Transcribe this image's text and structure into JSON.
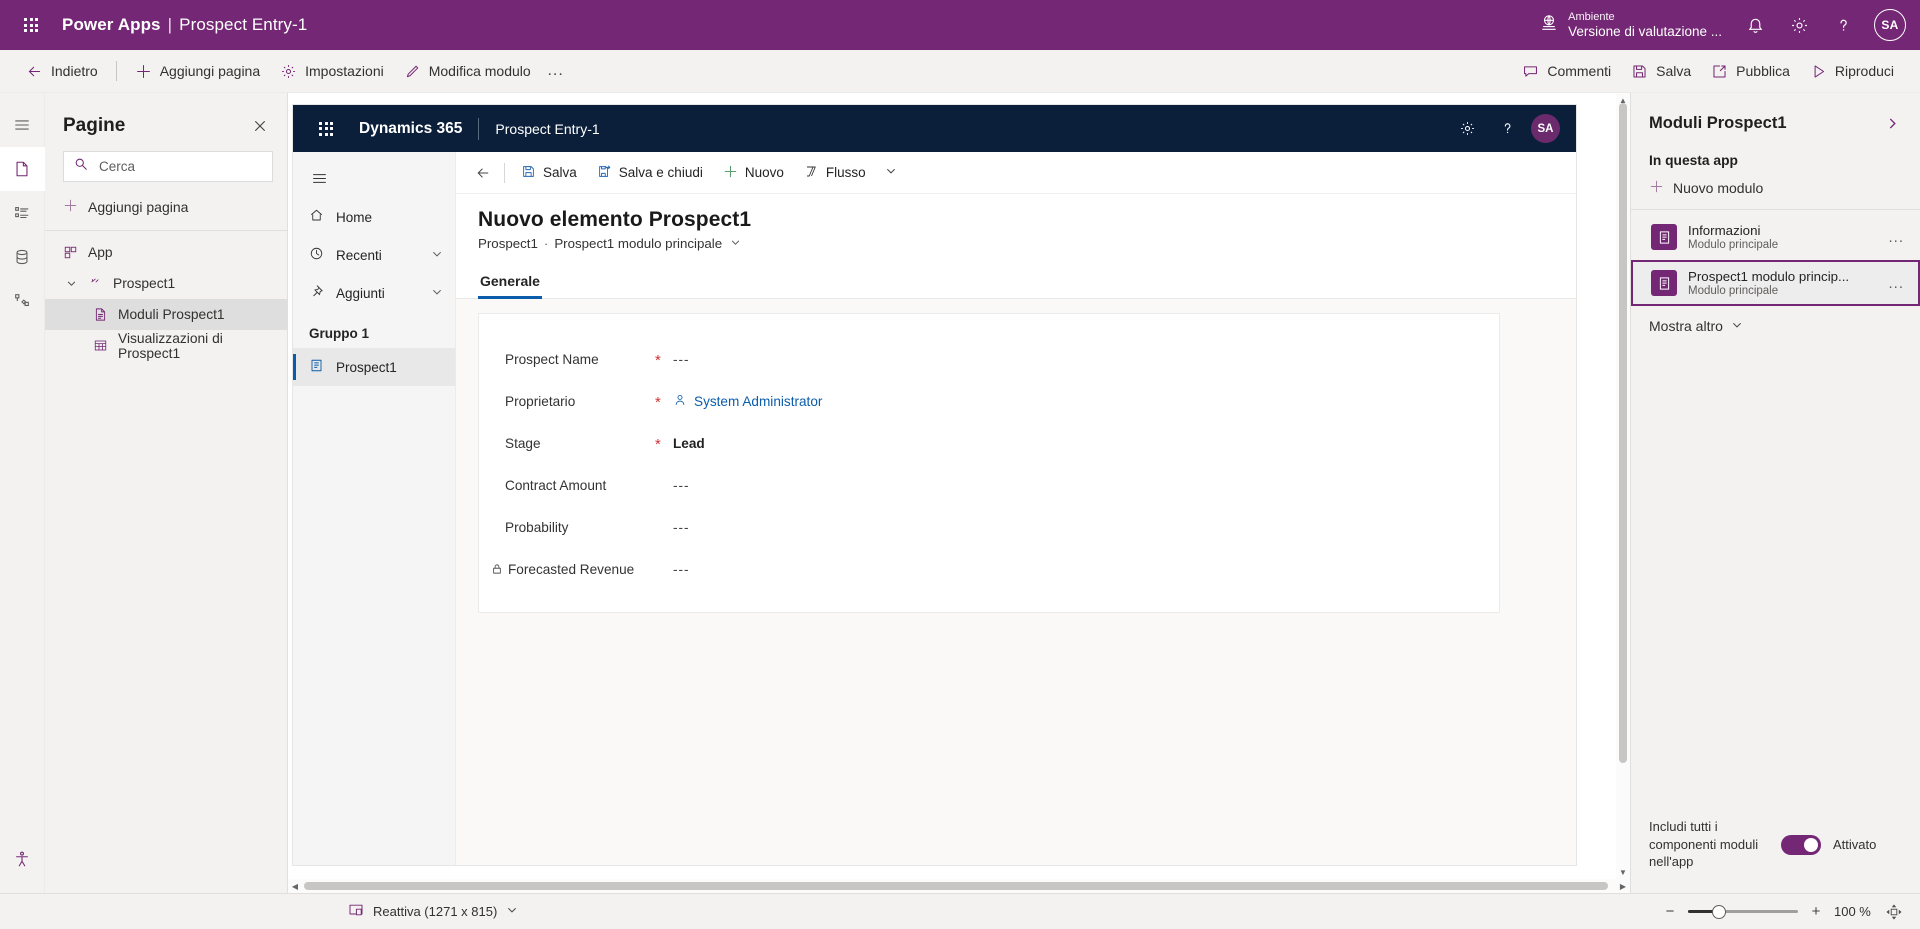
{
  "topbar": {
    "waffle_icon": "app-launcher-icon",
    "brand": "Power Apps",
    "separator": "|",
    "app_name": "Prospect Entry-1",
    "environment_label": "Ambiente",
    "environment_value": "Versione di valutazione ...",
    "globe_icon": "environment-globe-icon",
    "notifications_icon": "bell-icon",
    "settings_icon": "gear-icon",
    "help_icon": "question-icon",
    "avatar_initials": "SA",
    "accent_color": "#742774"
  },
  "commandbar": {
    "back": "Indietro",
    "add_page": "Aggiungi pagina",
    "settings": "Impostazioni",
    "edit_form": "Modifica modulo",
    "overflow": "...",
    "comments": "Commenti",
    "save": "Salva",
    "publish": "Pubblica",
    "play": "Riproduci"
  },
  "rail": {
    "items": [
      {
        "name": "hamburger-menu-icon"
      },
      {
        "name": "pages-icon",
        "active": true
      },
      {
        "name": "navigation-icon"
      },
      {
        "name": "data-icon"
      },
      {
        "name": "automation-icon"
      },
      {
        "name": "accessibility-icon"
      }
    ]
  },
  "pages_panel": {
    "title": "Pagine",
    "close_icon": "close-icon",
    "search_placeholder": "Cerca",
    "search_value": "",
    "add_page": "Aggiungi pagina",
    "tree": [
      {
        "label": "App",
        "icon": "app-icon",
        "level": 1,
        "selected": false,
        "expandable": false
      },
      {
        "label": "Prospect1",
        "icon": "table-entity-icon",
        "level": 2,
        "selected": false,
        "expandable": true
      },
      {
        "label": "Moduli Prospect1",
        "icon": "form-icon",
        "level": 3,
        "selected": true,
        "expandable": false
      },
      {
        "label": "Visualizzazioni di Prospect1",
        "icon": "view-grid-icon",
        "level": 3,
        "selected": false,
        "expandable": false
      }
    ]
  },
  "canvas": {
    "d365": {
      "waffle_icon": "app-launcher-icon",
      "brand": "Dynamics 365",
      "app_name": "Prospect Entry-1",
      "settings_icon": "gear-icon",
      "help_icon": "question-icon",
      "avatar_initials": "SA"
    },
    "sitemap": {
      "hamburger_icon": "hamburger-menu-icon",
      "items": [
        {
          "label": "Home",
          "icon": "home-icon",
          "chevron": false
        },
        {
          "label": "Recenti",
          "icon": "clock-icon",
          "chevron": true
        },
        {
          "label": "Aggiunti",
          "icon": "pin-icon",
          "chevron": true
        }
      ],
      "group_label": "Gruppo 1",
      "group_items": [
        {
          "label": "Prospect1",
          "icon": "entity-icon",
          "selected": true
        }
      ]
    },
    "form_command": {
      "back_icon": "back-arrow-icon",
      "save": "Salva",
      "save_and_close": "Salva e chiudi",
      "new": "Nuovo",
      "flow": "Flusso"
    },
    "form": {
      "title": "Nuovo elemento Prospect1",
      "breadcrumb_entity": "Prospect1",
      "breadcrumb_separator": "·",
      "breadcrumb_form": "Prospect1 modulo principale",
      "tabs": [
        {
          "label": "Generale",
          "active": true
        }
      ],
      "fields": [
        {
          "label": "Prospect Name",
          "required": true,
          "value": "---",
          "style": "empty",
          "locked": false
        },
        {
          "label": "Proprietario",
          "required": true,
          "value": "System Administrator",
          "style": "link",
          "icon": "person-icon",
          "locked": false
        },
        {
          "label": "Stage",
          "required": true,
          "value": "Lead",
          "style": "bold",
          "locked": false
        },
        {
          "label": "Contract Amount",
          "required": false,
          "value": "---",
          "style": "empty",
          "locked": false
        },
        {
          "label": "Probability",
          "required": false,
          "value": "---",
          "style": "empty",
          "locked": false
        },
        {
          "label": "Forecasted Revenue",
          "required": false,
          "value": "---",
          "style": "empty",
          "locked": true,
          "lock_icon": "lock-icon"
        }
      ]
    }
  },
  "statusbar": {
    "screen_icon": "responsive-screen-icon",
    "screen_label": "Reattiva (1271 x 815)",
    "chevron_icon": "chevron-down-icon",
    "zoom_out_icon": "minus-icon",
    "zoom_in_icon": "plus-icon",
    "zoom_value": "100 %",
    "fit_icon": "fit-to-screen-icon"
  },
  "right_panel": {
    "title": "Moduli Prospect1",
    "collapse_icon": "chevron-right-icon",
    "section_label": "In questa app",
    "new_form": "Nuovo modulo",
    "items": [
      {
        "name": "Informazioni",
        "subtitle": "Modulo principale",
        "icon": "form-icon",
        "selected": false,
        "more": "..."
      },
      {
        "name": "Prospect1 modulo princip...",
        "subtitle": "Modulo principale",
        "icon": "form-icon",
        "selected": true,
        "more": "..."
      }
    ],
    "show_more": "Mostra altro",
    "footer_label": "Includi tutti i componenti moduli nell'app",
    "toggle_state": "Attivato",
    "toggle_on": true
  }
}
